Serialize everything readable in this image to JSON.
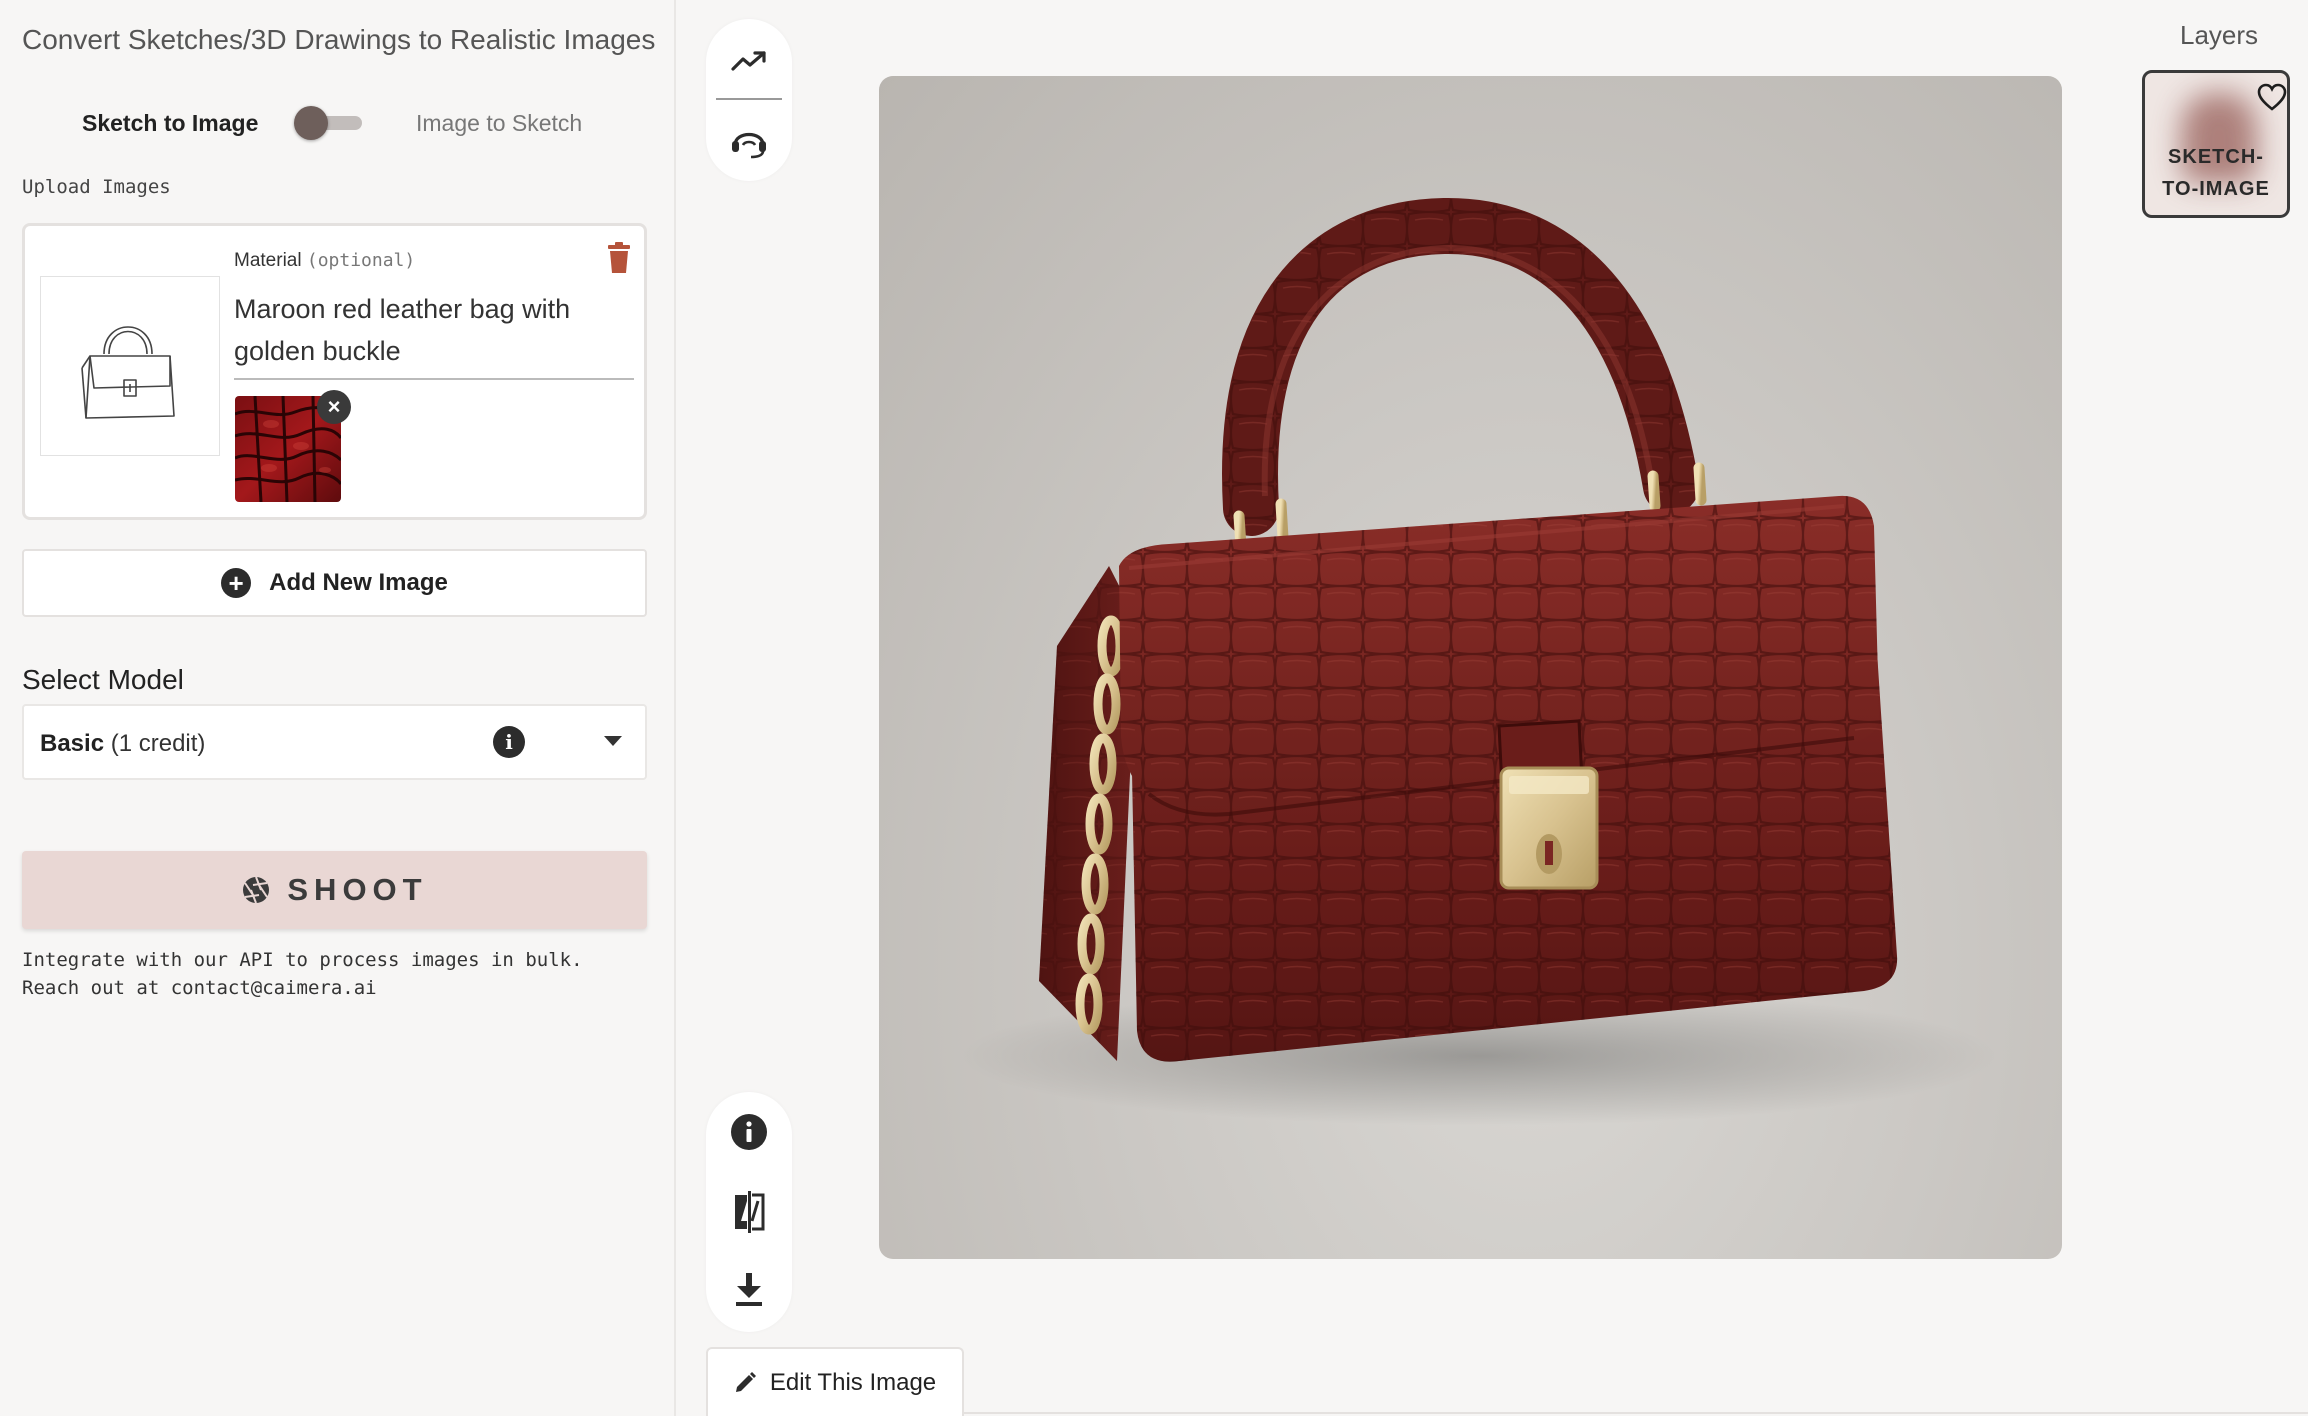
{
  "page": {
    "title": "Convert Sketches/3D Drawings to Realistic Images"
  },
  "mode_toggle": {
    "left_label": "Sketch to Image",
    "right_label": "Image to Sketch",
    "active": "Sketch to Image"
  },
  "upload": {
    "section_label": "Upload Images",
    "card": {
      "material_label": "Material",
      "material_optional": "(optional)",
      "material_text": "Maroon red leather bag with golden buckle"
    },
    "add_button_label": "Add New Image"
  },
  "model": {
    "section_label": "Select Model",
    "selected_name": "Basic",
    "selected_credit": "(1 credit)"
  },
  "shoot": {
    "label": "SHOOT"
  },
  "api_note": {
    "line1": "Integrate with our API to process images in bulk.",
    "line2": "Reach out at contact@caimera.ai"
  },
  "editor": {
    "edit_button_label": "Edit This Image"
  },
  "layers": {
    "title": "Layers",
    "items": [
      {
        "tag_line1": "SKETCH-",
        "tag_line2": "TO-IMAGE"
      }
    ]
  },
  "icons": {
    "top_tools": [
      "trending-up-icon",
      "support-headset-icon"
    ],
    "bottom_tools": [
      "info-icon",
      "compare-icon",
      "download-icon"
    ]
  },
  "colors": {
    "shoot_bg": "#e9d7d4",
    "delete_icon": "#b5533a",
    "bag_maroon": "#6e1f1c",
    "hardware_gold": "#d8c28f"
  }
}
